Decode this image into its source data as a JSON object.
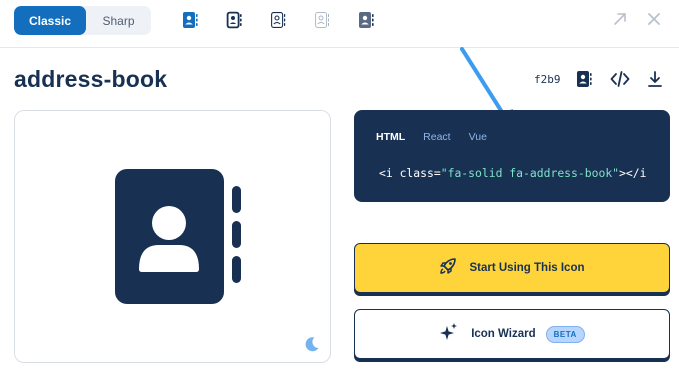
{
  "topbar": {
    "family_tabs": [
      {
        "label": "Classic",
        "active": true
      },
      {
        "label": "Sharp",
        "active": false
      }
    ],
    "style_icons": [
      "address-book-solid-icon",
      "address-book-regular-icon",
      "address-book-light-icon",
      "address-book-thin-icon",
      "address-book-duotone-icon"
    ],
    "actions": [
      "expand-icon",
      "close-icon"
    ]
  },
  "header": {
    "title": "address-book",
    "unicode": "f2b9",
    "actions": [
      "address-book-glyph-icon",
      "code-icon",
      "download-icon"
    ]
  },
  "preview": {
    "icon": "address-book-icon",
    "theme_toggle": "moon-icon"
  },
  "code": {
    "tabs": [
      {
        "label": "HTML",
        "active": true
      },
      {
        "label": "React",
        "active": false
      },
      {
        "label": "Vue",
        "active": false
      }
    ],
    "snippet": {
      "open": "<i class=",
      "value": "\"fa-solid fa-address-book\"",
      "close": "></i"
    }
  },
  "buttons": {
    "start_label": "Start Using This Icon",
    "wizard_label": "Icon Wizard",
    "wizard_badge": "BETA"
  },
  "colors": {
    "navy": "#183153",
    "brand_blue": "#146ebe",
    "yellow": "#ffd43b",
    "arrow": "#3d9cf0"
  }
}
